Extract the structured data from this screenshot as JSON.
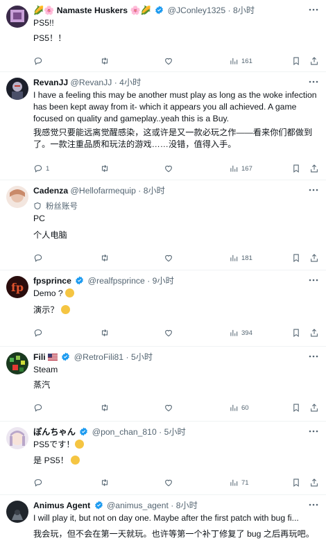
{
  "tweets": [
    {
      "name": "Namaste Huskers",
      "name_prefix": "🌽🌸",
      "name_suffix": "🌸🌽",
      "handle": "@JConley1325",
      "dot": "·",
      "time": "8小时",
      "lines": [
        "PS5!!",
        "PS5！！"
      ],
      "counts": {
        "reply": "",
        "retweet": "",
        "like": "",
        "views": "161"
      }
    },
    {
      "name": "RevanJJ",
      "handle": "@RevanJJ",
      "dot": "·",
      "time": "4小时",
      "lines": [
        "I have a feeling this may be another must play as long as the woke infection",
        "has been kept away from it- which it appears you all achieved. A game",
        "focused on quality and gameplay..yeah this is a Buy.",
        "我感觉只要能远离觉醒感染，这或许是又一款必玩之作——看来你们都做到",
        "了。一款注重品质和玩法的游戏……没错，值得入手。"
      ],
      "counts": {
        "reply": "1",
        "retweet": "",
        "like": "",
        "views": "167"
      }
    },
    {
      "name": "Cadenza",
      "handle": "@Hellofarmequip",
      "dot": "·",
      "time": "8小时",
      "community": "粉丝账号",
      "lines": [
        "PC",
        "个人电脑"
      ],
      "counts": {
        "reply": "",
        "retweet": "",
        "like": "",
        "views": "181"
      }
    },
    {
      "name": "fpsprince",
      "handle": "@realfpsprince",
      "dot": "·",
      "time": "9小时",
      "lines": [
        "Demo ?",
        "演示？"
      ],
      "counts": {
        "reply": "",
        "retweet": "",
        "like": "",
        "views": "394"
      }
    },
    {
      "name": "Fili",
      "handle": "@RetroFili81",
      "dot": "·",
      "time": "5小时",
      "lines": [
        "Steam",
        "蒸汽"
      ],
      "counts": {
        "reply": "",
        "retweet": "",
        "like": "",
        "views": "60"
      }
    },
    {
      "name": "ぽんちゃん",
      "handle": "@pon_chan_810",
      "dot": "·",
      "time": "5小时",
      "lines": [
        "PS5です！",
        "是 PS5！"
      ],
      "counts": {
        "reply": "",
        "retweet": "",
        "like": "",
        "views": "71"
      }
    },
    {
      "name": "Animus Agent",
      "handle": "@animus_agent",
      "dot": "·",
      "time": "8小时",
      "lines": [
        "I will play it, but not on day one. Maybe after the first patch with bug fi...",
        "我会玩，但不会在第一天就玩。也许等第一个补丁修复了 bug 之后再玩吧。"
      ],
      "counts": {
        "reply": "",
        "retweet": "",
        "like": "",
        "views": ""
      }
    }
  ],
  "colors": {
    "verified": "#1d9bf0",
    "muted": "#536471",
    "text": "#0f1419",
    "divider": "#eff3f4"
  },
  "icons": [
    "reply-icon",
    "retweet-icon",
    "like-icon",
    "views-icon",
    "bookmark-icon",
    "share-icon",
    "more-icon",
    "verified-badge-icon"
  ]
}
